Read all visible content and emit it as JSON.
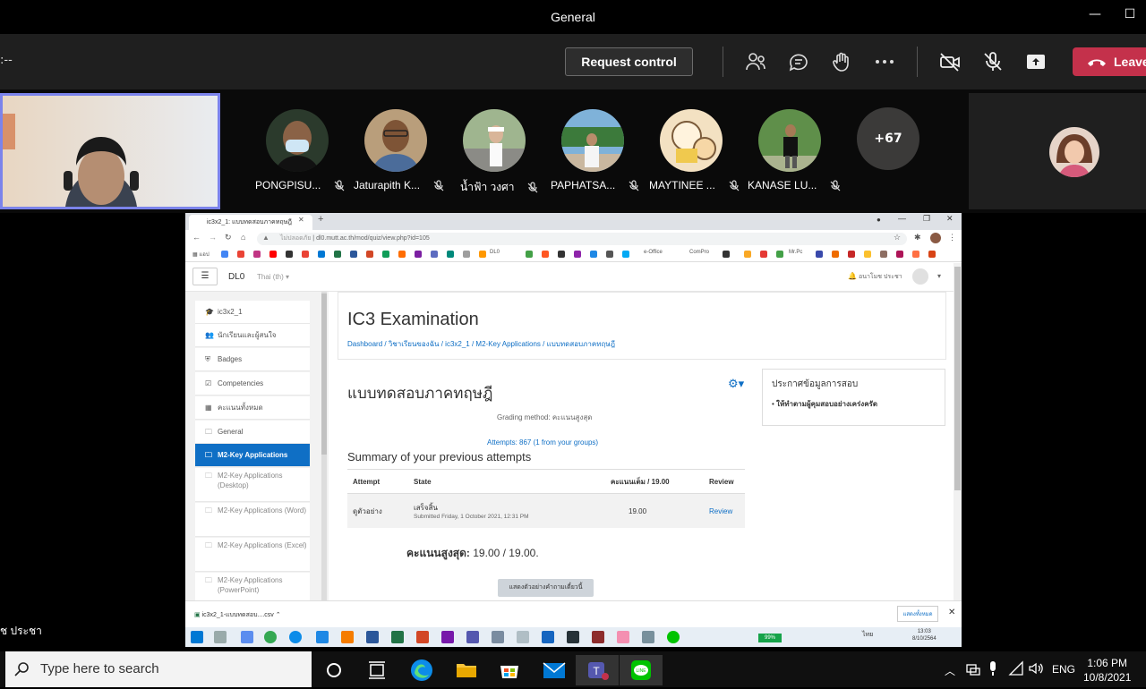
{
  "window": {
    "title": "General"
  },
  "toolbar": {
    "timer": ":--",
    "request_control": "Request control",
    "leave": "Leave"
  },
  "participants": [
    {
      "name": "PONGPISU..."
    },
    {
      "name": "Jaturapith K..."
    },
    {
      "name": "น้ำฟ้า วงศา"
    },
    {
      "name": "PAPHATSA..."
    },
    {
      "name": "MAYTINEE ..."
    },
    {
      "name": "KANASE LU..."
    }
  ],
  "more_count": "+67",
  "presenter_name": "ช ประชา",
  "browser": {
    "tab_title": "ic3x2_1: แบบทดสอบภาคทฤษฎี",
    "url": "dl0.mutt.ac.th/mod/quiz/view.php?id=105",
    "url_prefix": "ไม่ปลอดภัย",
    "bookmarks": [
      "แอป",
      "DL0",
      "e-Office",
      "ComPro",
      "Mr.Pc"
    ]
  },
  "moodle": {
    "brand": "DL0",
    "language": "Thai (th) ▾",
    "user": "อนาโมช ประชา",
    "page_title": "IC3 Examination",
    "breadcrumb": "Dashboard  /  วิชาเรียนของฉัน  /  ic3x2_1  /  M2-Key Applications  /  แบบทดสอบภาคทฤษฎี",
    "nav": [
      {
        "label": "ic3x2_1",
        "icon": "cap-icon"
      },
      {
        "label": "นักเรียนและผู้สนใจ",
        "icon": "users-icon"
      },
      {
        "label": "Badges",
        "icon": "shield-icon"
      },
      {
        "label": "Competencies",
        "icon": "check-icon"
      },
      {
        "label": "คะแนนทั้งหมด",
        "icon": "grid-icon"
      },
      {
        "label": "General",
        "icon": "folder-icon"
      },
      {
        "label": "M2-Key Applications",
        "icon": "folder-icon",
        "active": true
      },
      {
        "label": "M2-Key Applications (Desktop)",
        "icon": "folder-icon"
      },
      {
        "label": "M2-Key Applications (Word)",
        "icon": "folder-icon"
      },
      {
        "label": "M2-Key Applications (Excel)",
        "icon": "folder-icon"
      },
      {
        "label": "M2-Key Applications (PowerPoint)",
        "icon": "folder-icon"
      }
    ],
    "quiz_title": "แบบทดสอบภาคทฤษฎี",
    "grading_method": "Grading method: คะแนนสูงสุด",
    "attempts": "Attempts: 867 (1 from your groups)",
    "summary_heading": "Summary of your previous attempts",
    "table": {
      "headers": [
        "Attempt",
        "State",
        "คะแนนเต็ม / 19.00",
        "Review"
      ],
      "rows": [
        {
          "attempt": "ดูตัวอย่าง",
          "state": "เสร็จสิ้น",
          "submitted": "Submitted Friday, 1 October 2021, 12:31 PM",
          "grade": "19.00",
          "review": "Review"
        }
      ]
    },
    "best_grade_label": "คะแนนสูงสุด:",
    "best_grade_value": " 19.00 / 19.00.",
    "preview_button": "แสดงตัวอย่างคำถามเดี๋ยวนี้",
    "block_title": "ประกาศข้อมูลการสอบ",
    "block_item": "ให้ทำตามผู้คุมสอบอย่างเคร่งครัด"
  },
  "download_bar": {
    "file": "ic3x2_1-แบบทดสอบ....csv",
    "show_all": "แสดงทั้งหมด"
  },
  "remote_taskbar": {
    "battery": "99%",
    "time": "13:03",
    "date": "8/10/2564",
    "lang": "ไทย"
  },
  "taskbar": {
    "search_placeholder": "Type here to search",
    "time": "1:06 PM",
    "date": "10/8/2021",
    "lang": "ENG"
  },
  "colors": {
    "teams_purple": "#7b83eb",
    "leave_red": "#c4314b",
    "moodle_blue": "#0f6fc5"
  }
}
